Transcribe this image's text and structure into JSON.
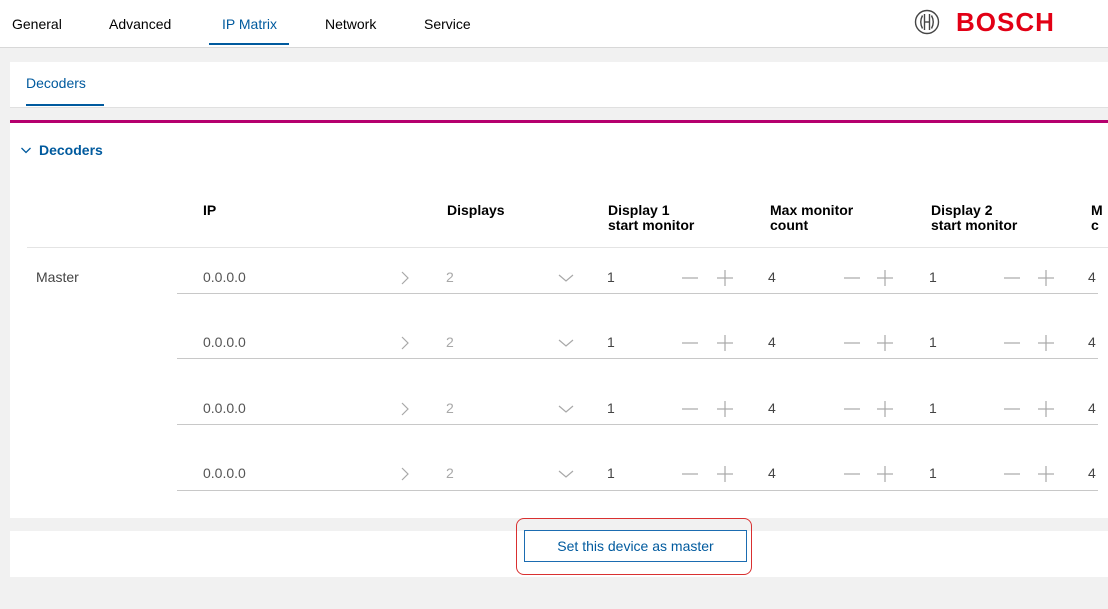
{
  "nav": {
    "tabs": [
      {
        "label": "General"
      },
      {
        "label": "Advanced"
      },
      {
        "label": "IP Matrix"
      },
      {
        "label": "Network"
      },
      {
        "label": "Service"
      }
    ],
    "active_tab": "IP Matrix"
  },
  "brand": {
    "logo_text": "BOSCH",
    "logo_icon": "bosch-armature-icon",
    "color": "#e20015"
  },
  "subnav": {
    "tabs": [
      {
        "label": "Decoders"
      }
    ]
  },
  "section": {
    "title": "Decoders",
    "toggle_icon": "chevron-down-icon"
  },
  "table": {
    "headers": {
      "ip": "IP",
      "displays": "Displays",
      "d1_start_line1": "Display 1",
      "d1_start_line2": "start monitor",
      "max_count_line1": "Max monitor",
      "max_count_line2": "count",
      "d2_start_line1": "Display 2",
      "d2_start_line2": "start monitor",
      "next_line1": "M",
      "next_line2": "c"
    },
    "rows": [
      {
        "label": "Master",
        "ip": "0.0.0.0",
        "displays": "2",
        "d1_start": "1",
        "max_count": "4",
        "d2_start": "1",
        "next": "4"
      },
      {
        "label": "",
        "ip": "0.0.0.0",
        "displays": "2",
        "d1_start": "1",
        "max_count": "4",
        "d2_start": "1",
        "next": "4"
      },
      {
        "label": "",
        "ip": "0.0.0.0",
        "displays": "2",
        "d1_start": "1",
        "max_count": "4",
        "d2_start": "1",
        "next": "4"
      },
      {
        "label": "",
        "ip": "0.0.0.0",
        "displays": "2",
        "d1_start": "1",
        "max_count": "4",
        "d2_start": "1",
        "next": "4"
      }
    ]
  },
  "actions": {
    "set_master_label": "Set this device as master"
  },
  "colors": {
    "accent": "#005a9e",
    "section_rule": "#b5006e",
    "highlight": "#d93030"
  }
}
